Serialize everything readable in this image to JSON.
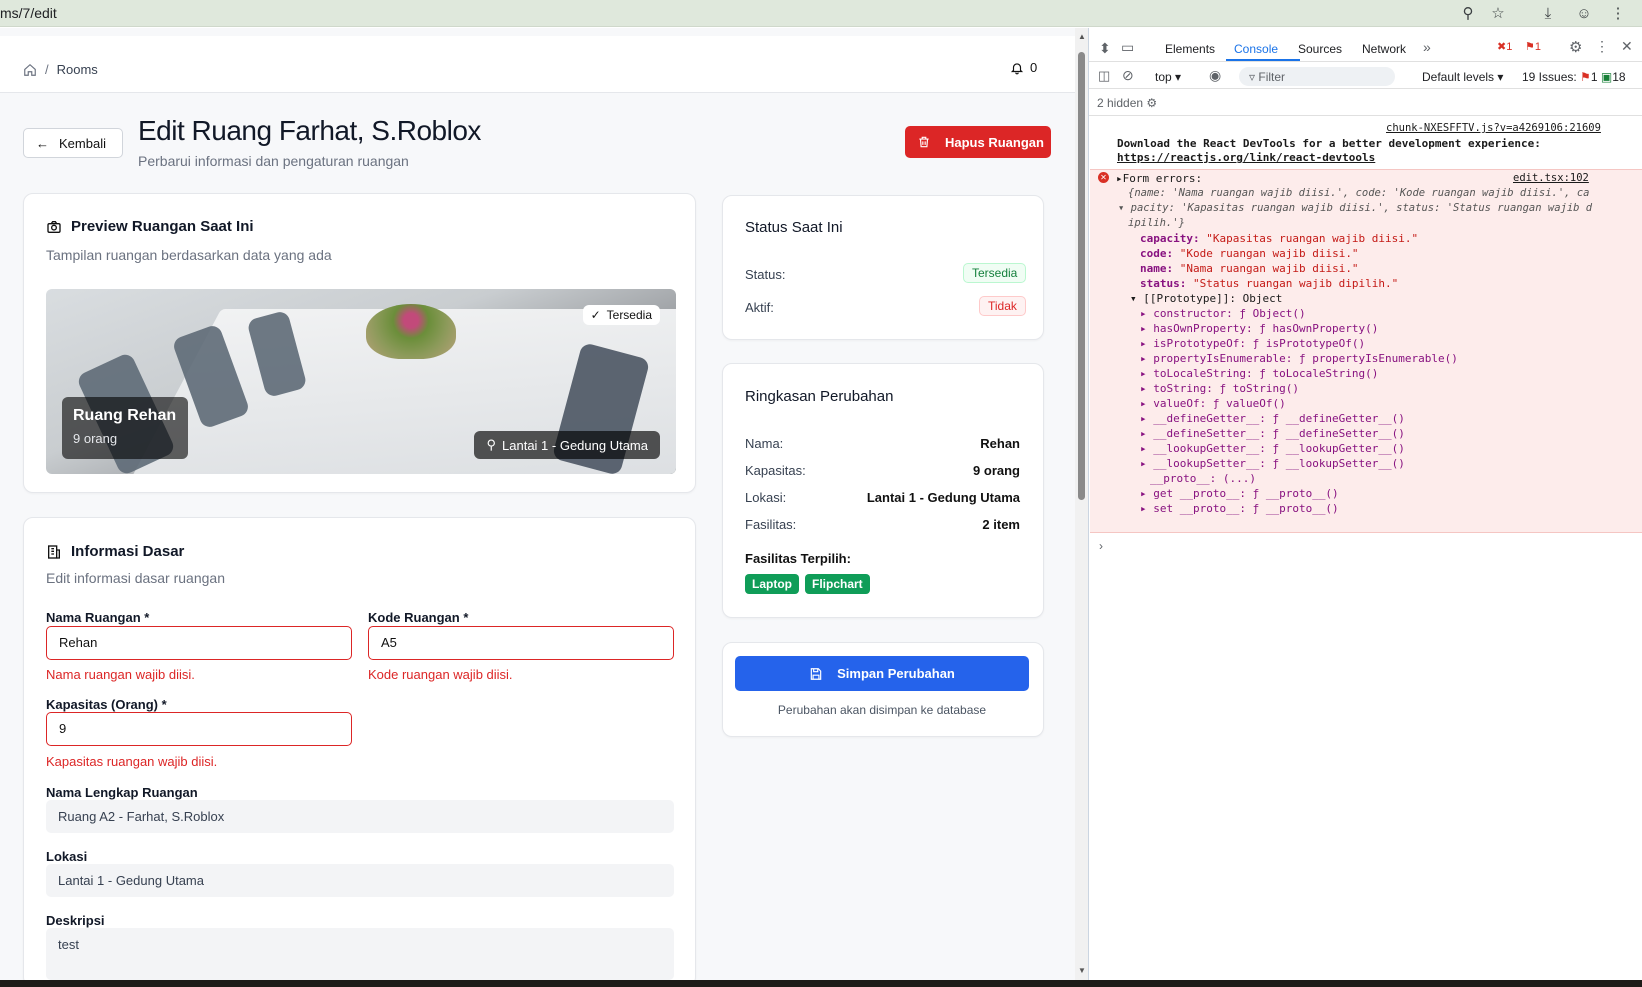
{
  "browser": {
    "url": "ms/7/edit"
  },
  "nav": {
    "breadcrumb": "Rooms",
    "notif_count": "0"
  },
  "header": {
    "back_label": "Kembali",
    "title": "Edit Ruang Farhat, S.Roblox",
    "subtitle": "Perbarui informasi dan pengaturan ruangan",
    "delete_label": "Hapus Ruangan"
  },
  "preview": {
    "title": "Preview Ruangan Saat Ini",
    "subtitle": "Tampilan ruangan berdasarkan data yang ada",
    "status_badge": "Tersedia",
    "room_name": "Ruang Rehan",
    "capacity": "9 orang",
    "location": "Lantai 1 - Gedung Utama"
  },
  "form": {
    "title": "Informasi Dasar",
    "subtitle": "Edit informasi dasar ruangan",
    "name_label": "Nama Ruangan *",
    "name_value": "Rehan",
    "name_error": "Nama ruangan wajib diisi.",
    "code_label": "Kode Ruangan *",
    "code_value": "A5",
    "code_error": "Kode ruangan wajib diisi.",
    "capacity_label": "Kapasitas (Orang) *",
    "capacity_value": "9",
    "capacity_error": "Kapasitas ruangan wajib diisi.",
    "fullname_label": "Nama Lengkap Ruangan",
    "fullname_value": "Ruang A2 - Farhat, S.Roblox",
    "location_label": "Lokasi",
    "location_value": "Lantai 1 - Gedung Utama",
    "description_label": "Deskripsi",
    "description_value": "test"
  },
  "status": {
    "title": "Status Saat Ini",
    "status_label": "Status:",
    "status_value": "Tersedia",
    "active_label": "Aktif:",
    "active_value": "Tidak"
  },
  "summary": {
    "title": "Ringkasan Perubahan",
    "rows": [
      {
        "label": "Nama:",
        "value": "Rehan"
      },
      {
        "label": "Kapasitas:",
        "value": "9 orang"
      },
      {
        "label": "Lokasi:",
        "value": "Lantai 1 - Gedung Utama"
      },
      {
        "label": "Fasilitas:",
        "value": "2 item"
      }
    ],
    "facilities_label": "Fasilitas Terpilih:",
    "facilities": [
      "Laptop",
      "Flipchart"
    ]
  },
  "save": {
    "label": "Simpan Perubahan",
    "note": "Perubahan akan disimpan ke database"
  },
  "devtools": {
    "tabs": [
      "Elements",
      "Console",
      "Sources",
      "Network"
    ],
    "active_tab": "Console",
    "error_count": "1",
    "warn_count": "1",
    "context": "top",
    "filter_placeholder": "Filter",
    "levels": "Default levels",
    "issues_label": "19 Issues:",
    "issues_err": "1",
    "issues_msg": "18",
    "hidden": "2 hidden",
    "source1": "chunk-NXESFFTV.js?v=a4269106:21609",
    "msg1_line1": "Download the React DevTools for a better development experience:",
    "msg1_link": "https://reactjs.org/link/react-devtools",
    "source2": "edit.tsx:102",
    "err_title": "Form errors:",
    "err_preview": "{name: 'Nama ruangan wajib diisi.', code: 'Kode ruangan wajib diisi.', ca",
    "err_preview2": "pacity: 'Kapasitas ruangan wajib diisi.', status: 'Status ruangan wajib d",
    "err_preview3": "ipilih.'}",
    "props": [
      {
        "k": "capacity:",
        "v": "\"Kapasitas ruangan wajib diisi.\""
      },
      {
        "k": "code:",
        "v": "\"Kode ruangan wajib diisi.\""
      },
      {
        "k": "name:",
        "v": "\"Nama ruangan wajib diisi.\""
      },
      {
        "k": "status:",
        "v": "\"Status ruangan wajib dipilih.\""
      }
    ],
    "proto": "[[Prototype]]: Object",
    "methods": [
      "constructor: ƒ Object()",
      "hasOwnProperty: ƒ hasOwnProperty()",
      "isPrototypeOf: ƒ isPrototypeOf()",
      "propertyIsEnumerable: ƒ propertyIsEnumerable()",
      "toLocaleString: ƒ toLocaleString()",
      "toString: ƒ toString()",
      "valueOf: ƒ valueOf()",
      "__defineGetter__: ƒ __defineGetter__()",
      "__defineSetter__: ƒ __defineSetter__()",
      "__lookupGetter__: ƒ __lookupGetter__()",
      "__lookupSetter__: ƒ __lookupSetter__()",
      "__proto__: (...)",
      "get __proto__: ƒ __proto__()",
      "set __proto__: ƒ __proto__()"
    ]
  }
}
